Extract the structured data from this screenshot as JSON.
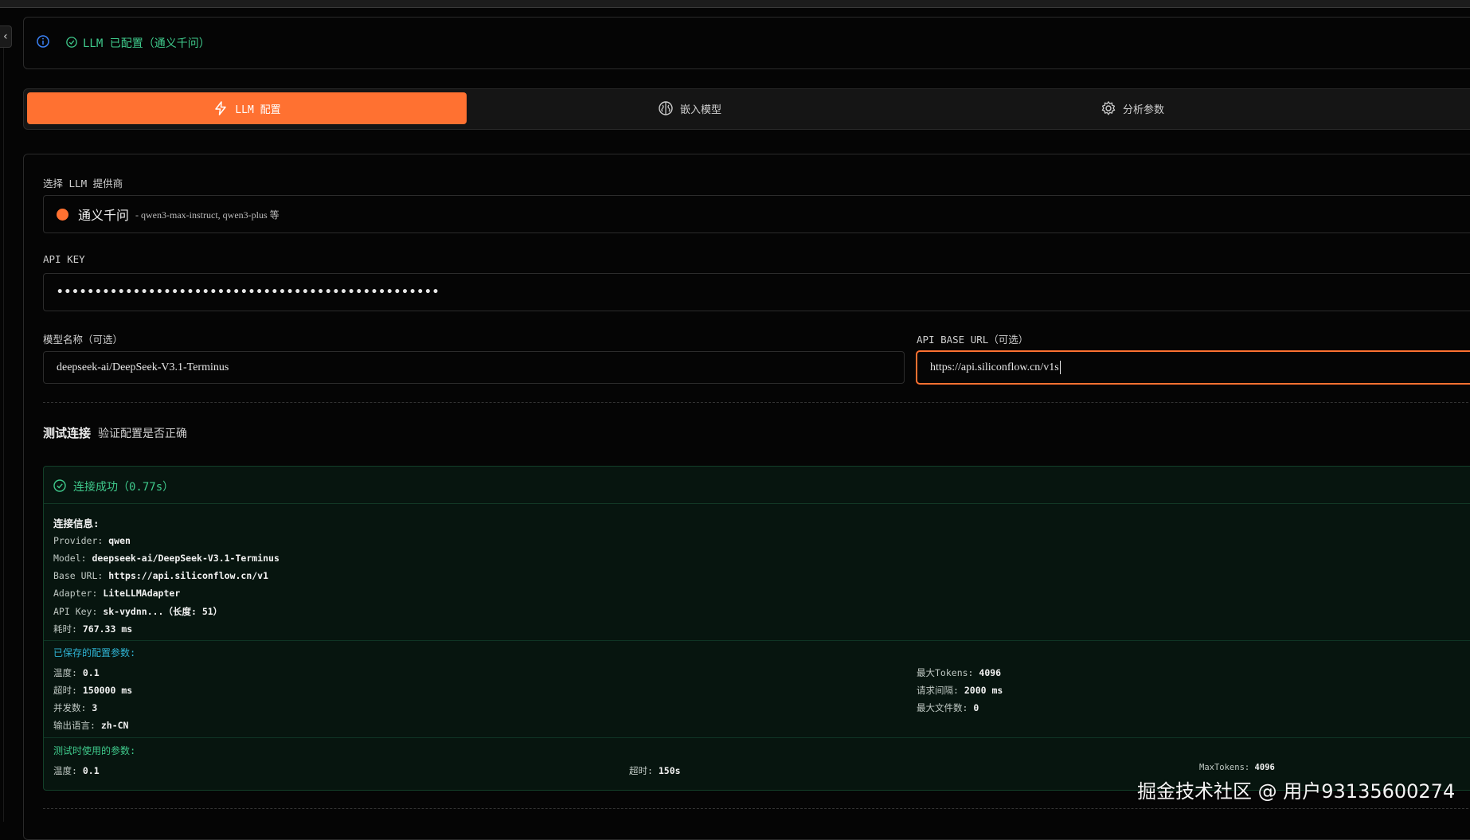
{
  "status": {
    "text": "LLM 已配置（通义千问）"
  },
  "tabs": [
    {
      "label": "LLM 配置",
      "icon": "lightning-icon",
      "active": true
    },
    {
      "label": "嵌入模型",
      "icon": "brain-icon",
      "active": false
    },
    {
      "label": "分析参数",
      "icon": "gear-icon",
      "active": false
    }
  ],
  "form": {
    "provider_label": "选择 LLM 提供商",
    "provider_name": "通义千问",
    "provider_desc": "- qwen3-max-instruct, qwen3-plus 等",
    "api_key_label": "API KEY",
    "api_key_value": "••••••••••••••••••••••••••••••••••••••••••••••••••",
    "model_label": "模型名称（可选）",
    "model_value": "deepseek-ai/DeepSeek-V3.1-Terminus",
    "base_url_label": "API BASE URL（可选）",
    "base_url_value": "https://api.siliconflow.cn/v1s"
  },
  "test": {
    "title": "测试连接",
    "subtitle": "验证配置是否正确"
  },
  "result": {
    "header": "连接成功（0.77s）",
    "info_title": "连接信息:",
    "info": [
      {
        "k": "Provider: ",
        "v": "qwen"
      },
      {
        "k": "Model: ",
        "v": "deepseek-ai/DeepSeek-V3.1-Terminus"
      },
      {
        "k": "Base URL: ",
        "v": "https://api.siliconflow.cn/v1"
      },
      {
        "k": "Adapter: ",
        "v": "LiteLLMAdapter"
      },
      {
        "k": "API Key: ",
        "v": "sk-vydnn...（长度: 51）"
      },
      {
        "k": "耗时: ",
        "v": "767.33 ms"
      }
    ],
    "saved_title": "已保存的配置参数:",
    "saved_left": [
      {
        "k": "温度: ",
        "v": "0.1"
      },
      {
        "k": "超时: ",
        "v": "150000 ms"
      },
      {
        "k": "并发数: ",
        "v": "3"
      },
      {
        "k": "输出语言: ",
        "v": "zh-CN"
      }
    ],
    "saved_right": [
      {
        "k": "最大Tokens: ",
        "v": "4096"
      },
      {
        "k": "请求间隔: ",
        "v": "2000 ms"
      },
      {
        "k": "最大文件数: ",
        "v": "0"
      }
    ],
    "test_title": "测试时使用的参数:",
    "test_params": [
      {
        "k": "温度: ",
        "v": "0.1"
      },
      {
        "k": "超时: ",
        "v": "150s"
      },
      {
        "k": "MaxTokens: ",
        "v": "4096"
      }
    ]
  },
  "watermark": "掘金技术社区 @ 用户93135600274",
  "colors": {
    "accent": "#ff7131",
    "success": "#3fca8c",
    "info": "#2fb4d4"
  }
}
